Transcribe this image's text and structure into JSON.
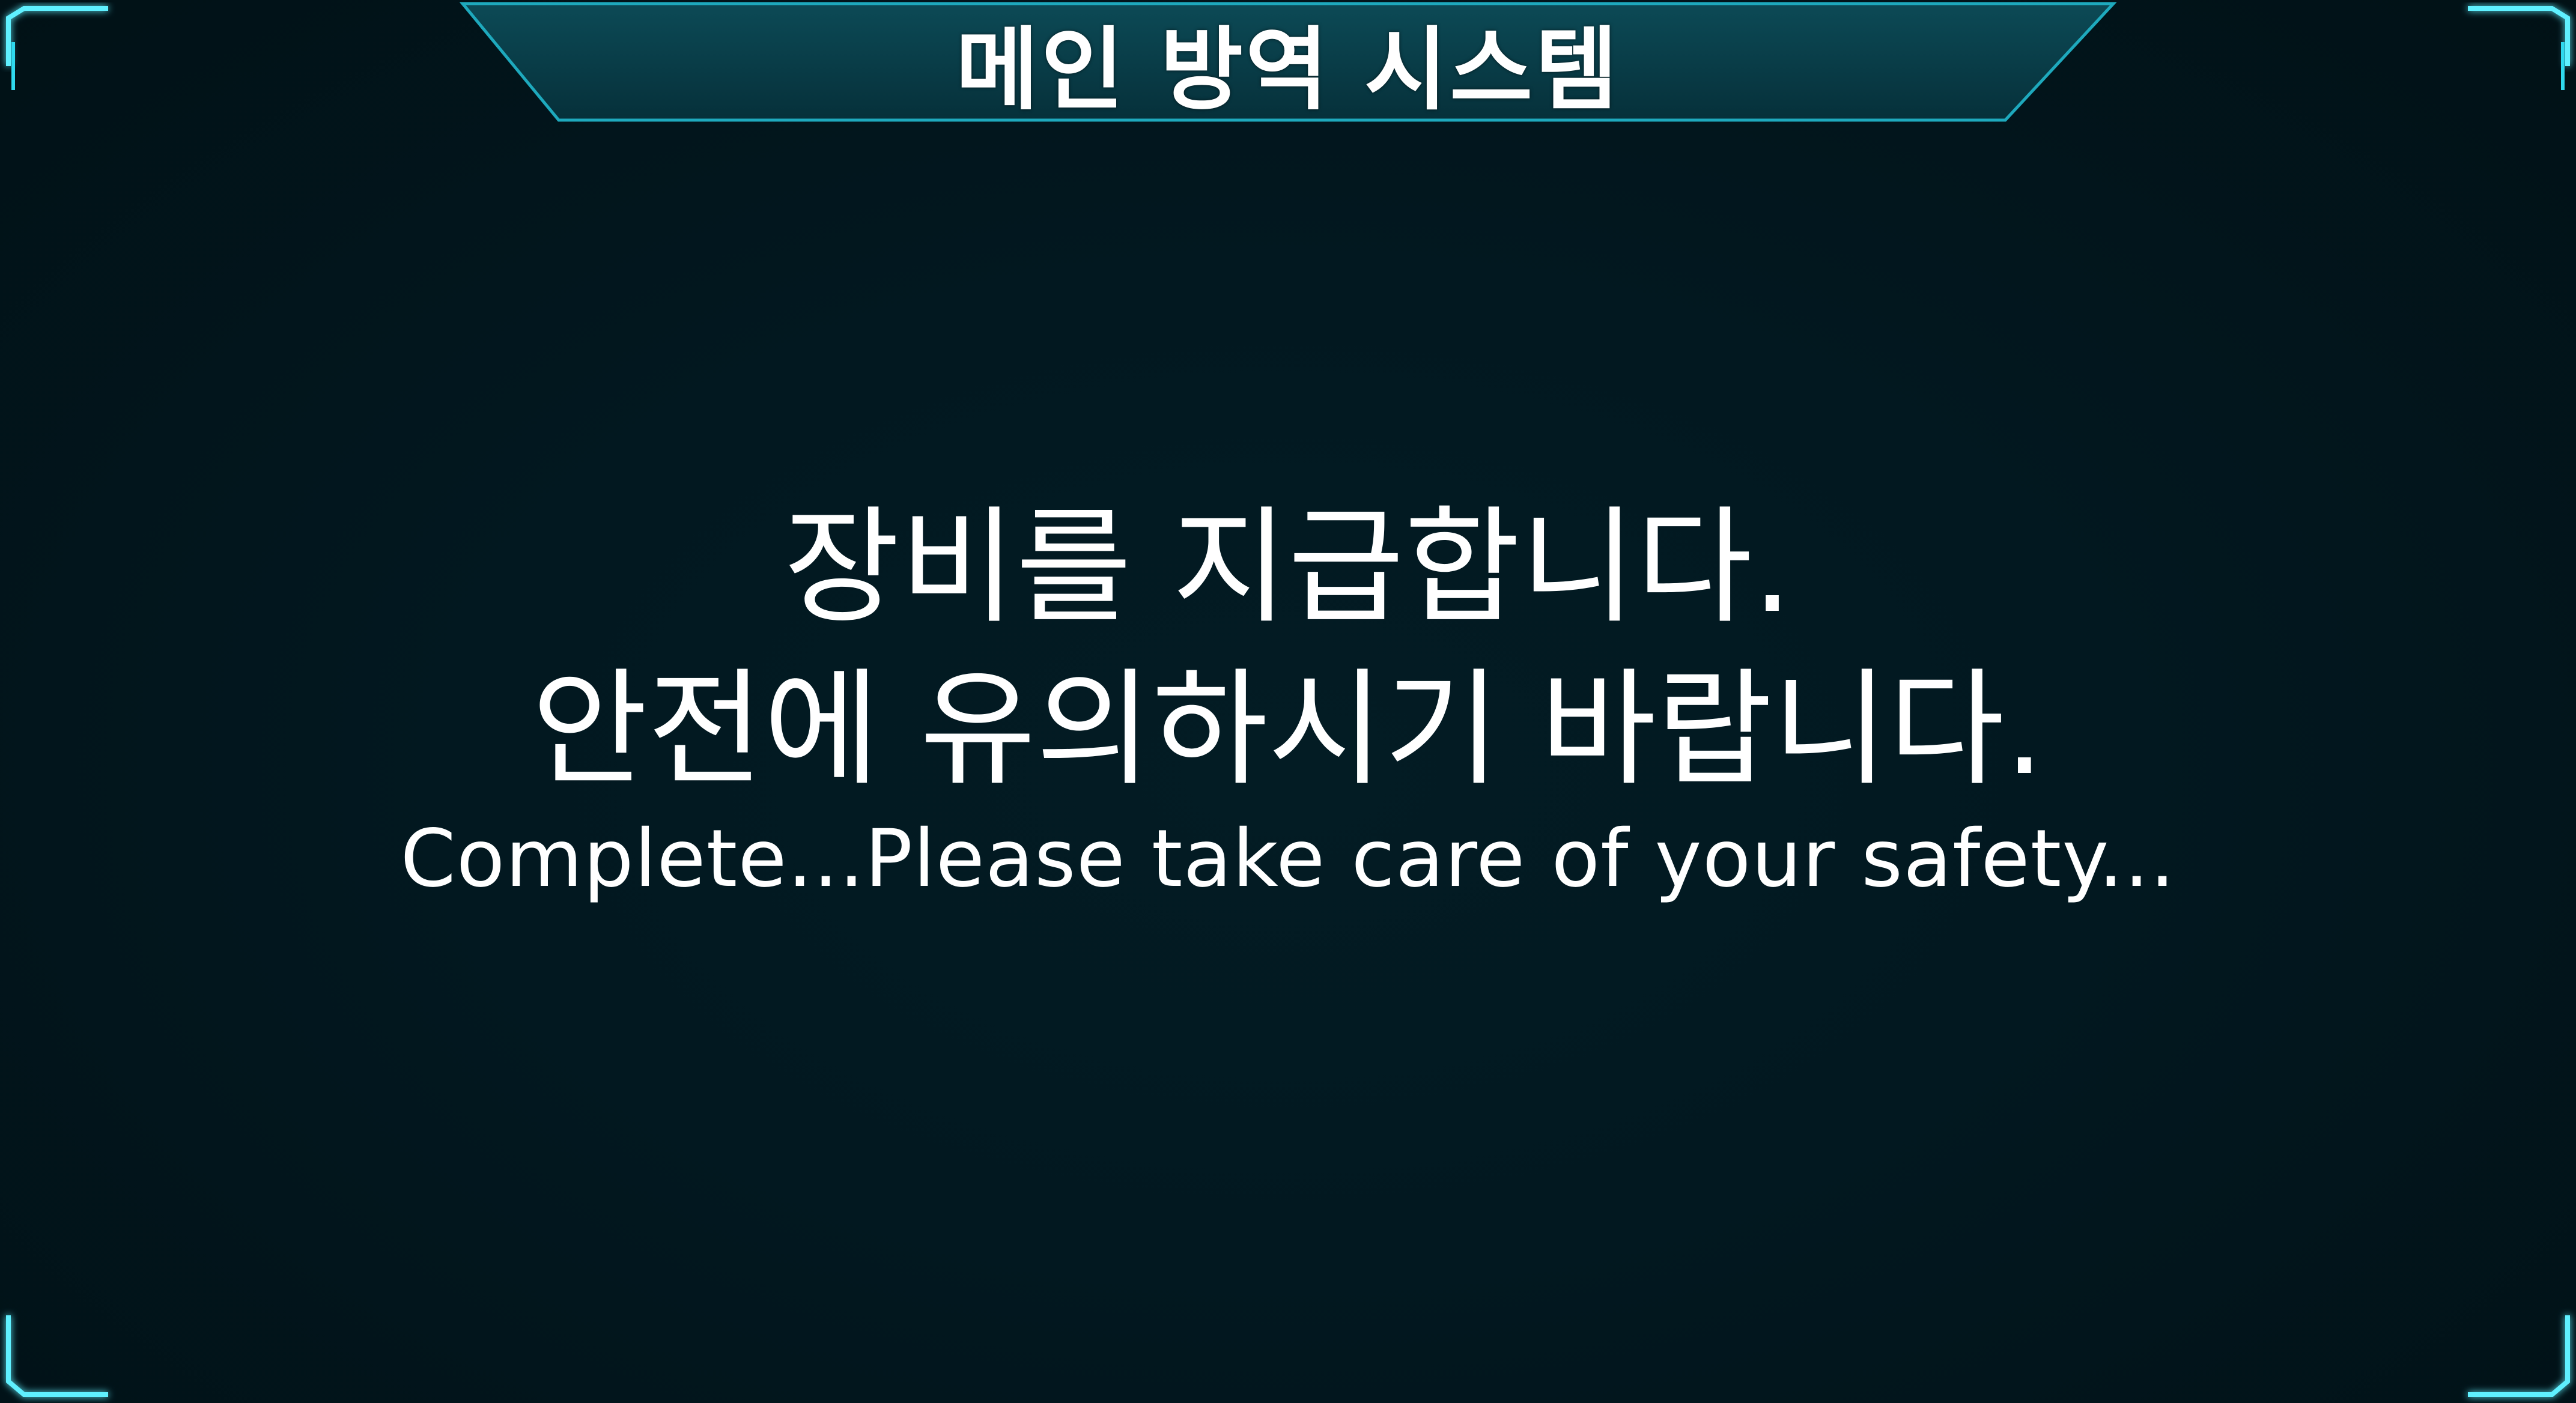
{
  "header": {
    "title": "메인 방역 시스템"
  },
  "message": {
    "line1": "장비를 지급합니다.",
    "line2": "안전에 유의하시기 바랍니다.",
    "english": "Complete...Please take care of your safety..."
  },
  "colors": {
    "background": "#011015",
    "frame_accent": "#2fd9ee",
    "header_panel": "#0a3d48",
    "text": "#ffffff"
  }
}
